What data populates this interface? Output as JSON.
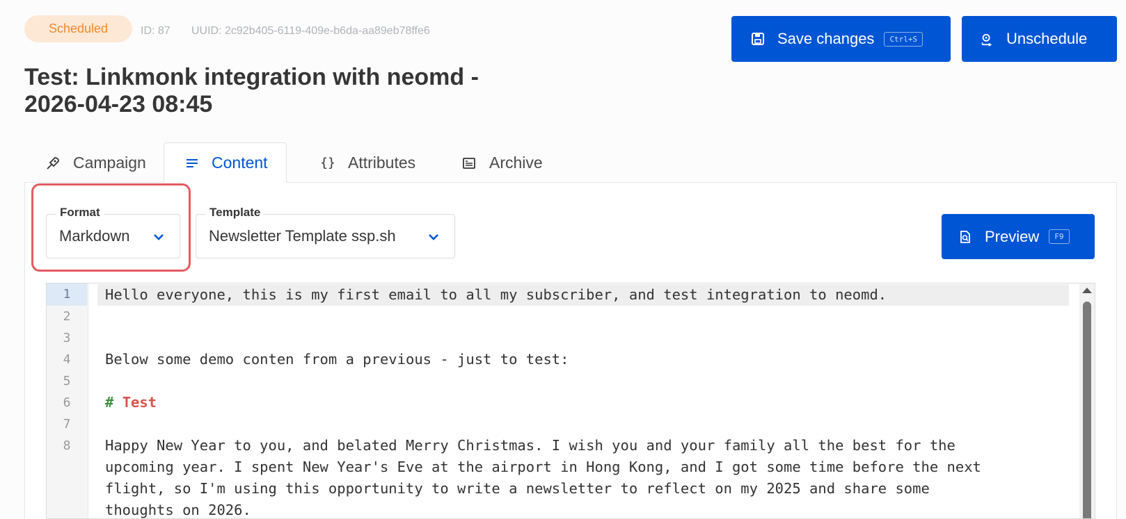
{
  "header": {
    "status_badge": "Scheduled",
    "id_text": "ID: 87",
    "uuid_text": "UUID: 2c92b405-6119-409e-b6da-aa89eb78ffe6",
    "title": "Test: Linkmonk integration with neomd - 2026-04-23 08:45"
  },
  "actions": {
    "save_label": "Save changes",
    "save_shortcut": "Ctrl+S",
    "unschedule_label": "Unschedule",
    "preview_label": "Preview",
    "preview_shortcut": "F9"
  },
  "tabs": [
    {
      "label": "Campaign",
      "icon": "rocket-icon"
    },
    {
      "label": "Content",
      "icon": "lines-icon",
      "active": true
    },
    {
      "label": "Attributes",
      "icon": "braces-icon"
    },
    {
      "label": "Archive",
      "icon": "archive-icon"
    }
  ],
  "form": {
    "format_label": "Format",
    "format_value": "Markdown",
    "template_label": "Template",
    "template_value": "Newsletter Template ssp.sh"
  },
  "editor": {
    "line_numbers": [
      "1",
      "2",
      "3",
      "4",
      "5",
      "6",
      "7",
      "8"
    ],
    "line1": "Hello everyone, this is my first email to all my subscriber, and test integration to neomd.",
    "line4": "Below some demo conten from a previous - just to test:",
    "line6_hash": "#",
    "line6_heading": "Test",
    "line8_a": "Happy New Year to you, and belated Merry Christmas. I wish you and your family all the best for the",
    "line8_b": "upcoming year. I spent New Year's Eve at the airport in Hong Kong, and I got some time before the next",
    "line8_c": "flight, so I'm using this opportunity to write a newsletter to reflect on my 2025 and share some",
    "line8_d": "thoughts on 2026."
  },
  "colors": {
    "primary": "#0055d4",
    "badge_bg": "#fde8d6",
    "badge_text": "#f08a2c",
    "highlight_border": "#e45b62"
  }
}
